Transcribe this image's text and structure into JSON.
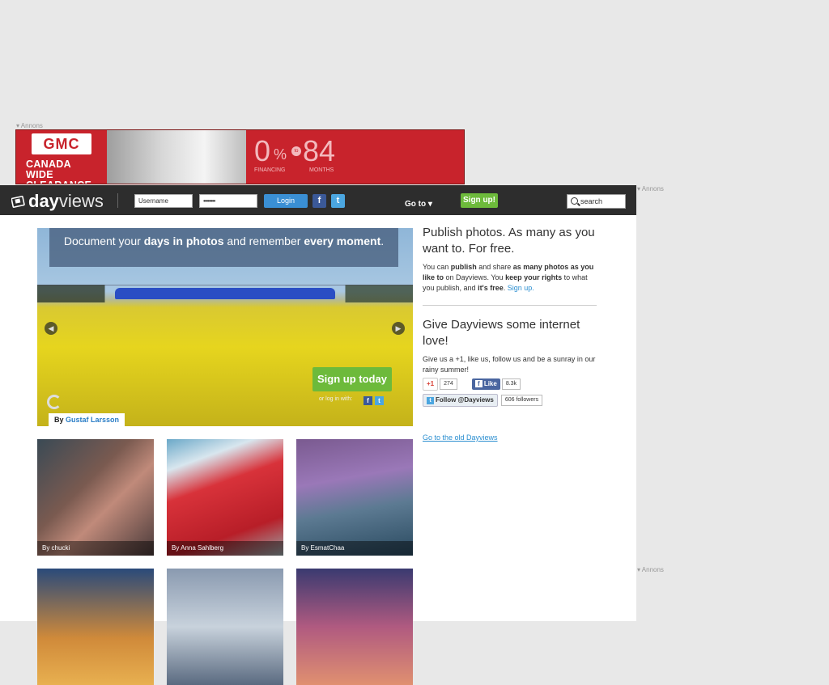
{
  "ads": {
    "top_label": "▾ Annons",
    "right_label_1": "▾ Annons",
    "right_label_2": "▾ Annons",
    "brand": "GMC",
    "headline": "CANADA WIDE CLEARANCE",
    "rate": "0",
    "rate_unit": "%",
    "to": "to",
    "months": "84",
    "financing_label": "FINANCING",
    "months_label": "MONTHS"
  },
  "header": {
    "logo_bold": "day",
    "logo_light": "views",
    "username_placeholder": "Username",
    "password_value": "••••••••",
    "login_label": "Login",
    "facebook_glyph": "f",
    "twitter_glyph": "t",
    "goto_label": "Go to ▾",
    "signup_label": "Sign up!",
    "search_placeholder": "search"
  },
  "hero": {
    "caption_pre": "Document your ",
    "caption_bold1": "days in photos",
    "caption_mid": " and remember ",
    "caption_bold2": "every moment",
    "caption_end": ".",
    "signup_label": "Sign up today",
    "login_with": "or log in with:",
    "by_prefix": "By",
    "author": "Gustaf Larsson",
    "prev_glyph": "◀",
    "next_glyph": "▶"
  },
  "thumbnails": [
    {
      "caption": "By chucki"
    },
    {
      "caption": "By Anna Sahlberg"
    },
    {
      "caption": "By EsmatChaa"
    }
  ],
  "sidebar": {
    "publish_title": "Publish photos. As many as you want to. For free.",
    "publish_text_1": "You can ",
    "publish_bold_1": "publish",
    "publish_text_2": " and share ",
    "publish_bold_2": "as many photos as you like to",
    "publish_text_3": " on Dayviews. You ",
    "publish_bold_3": "keep your rights",
    "publish_text_4": " to what you publish, and ",
    "publish_bold_4": "it's free",
    "publish_text_5": ". ",
    "publish_link": "Sign up.",
    "love_title": "Give Dayviews some internet love!",
    "love_text": "Give us a +1, like us, follow us and be a sunray in our rainy summer!",
    "gplus_label": "+1",
    "gplus_count": "274",
    "fb_like_label": "Like",
    "fb_like_count": "8.3k",
    "follow_label": "Follow @Dayviews",
    "followers": "606 followers",
    "old_link": "Go to the old Dayviews"
  },
  "colors": {
    "header_bg": "#2d2d2d",
    "login_blue": "#3a8fd4",
    "signup_green": "#6dba3b",
    "link_blue": "#2a8ed0",
    "ad_red": "#c8232c"
  }
}
